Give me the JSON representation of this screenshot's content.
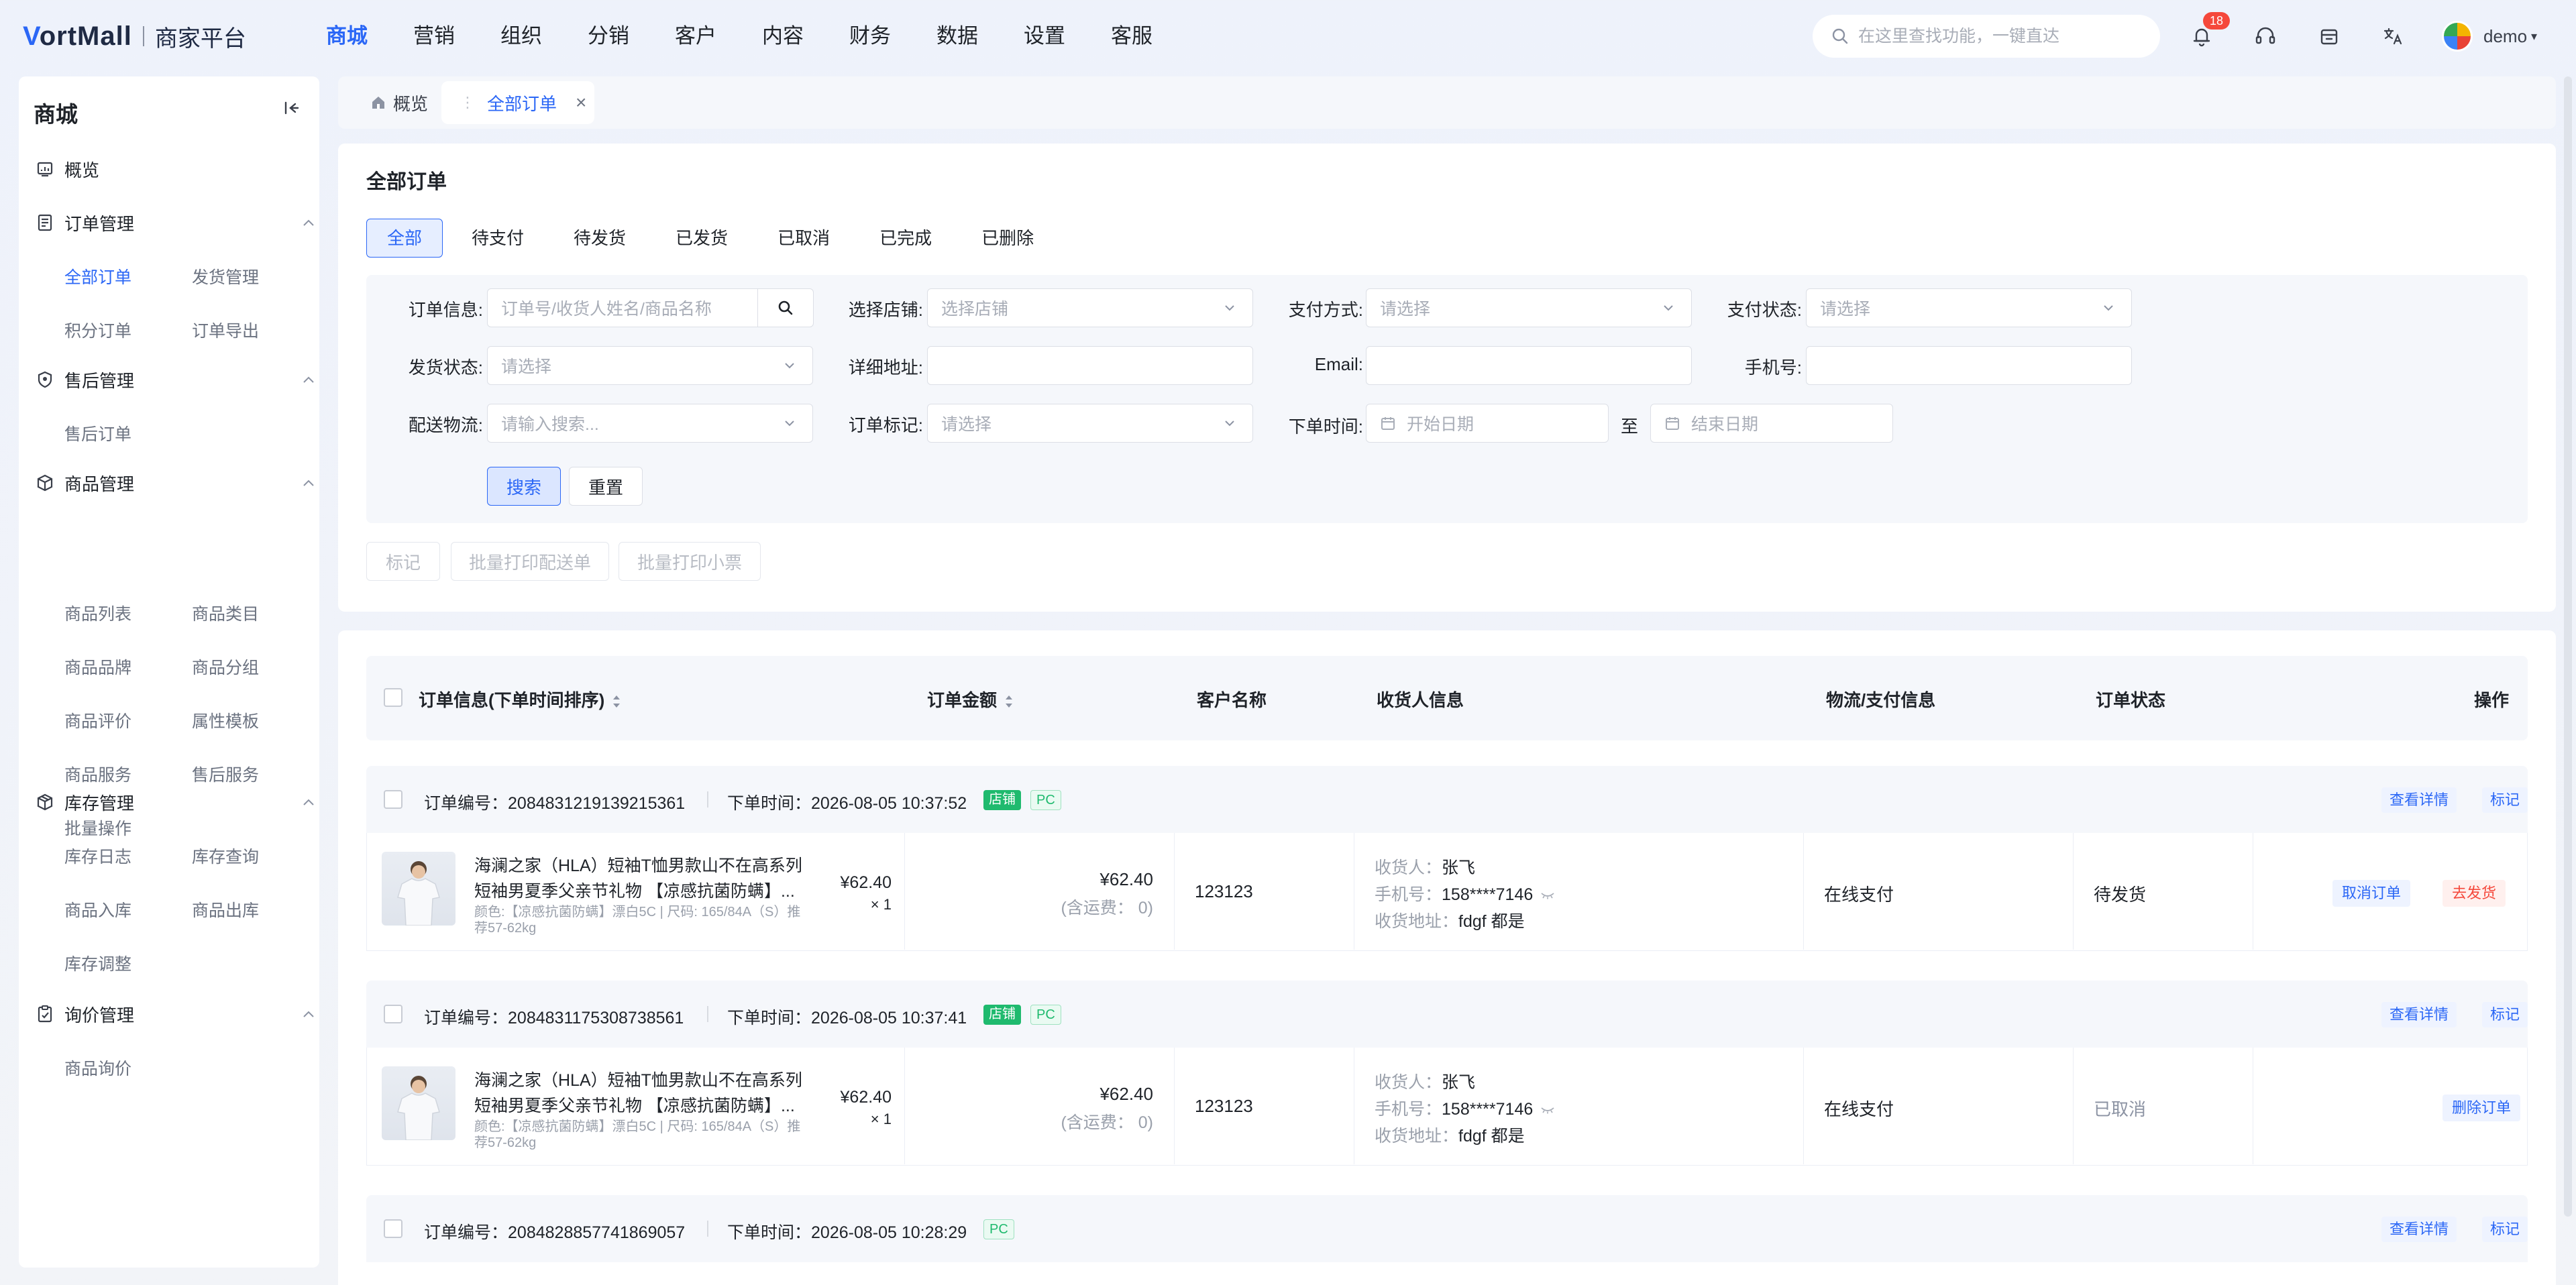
{
  "brand": {
    "logo_mark_v": "V",
    "logo_mark_rest": "ortMall",
    "subtitle": "商家平台"
  },
  "topnav": [
    "商城",
    "营销",
    "组织",
    "分销",
    "客户",
    "内容",
    "财务",
    "数据",
    "设置",
    "客服"
  ],
  "search": {
    "placeholder": "在这里查找功能，一键直达"
  },
  "notifications": {
    "count": "18"
  },
  "user": {
    "name": "demo"
  },
  "sidebar": {
    "title": "商城",
    "overview": "概览",
    "groups": [
      {
        "title": "订单管理",
        "items": [
          "全部订单",
          "发货管理",
          "积分订单",
          "订单导出"
        ]
      },
      {
        "title": "售后管理",
        "items": [
          "售后订单"
        ]
      },
      {
        "title": "商品管理",
        "items": [
          "商品列表",
          "商品类目",
          "商品品牌",
          "商品分组",
          "商品评价",
          "属性模板",
          "商品服务",
          "售后服务",
          "批量操作"
        ]
      },
      {
        "title": "库存管理",
        "items": [
          "库存日志",
          "库存查询",
          "商品入库",
          "商品出库",
          "库存调整"
        ]
      },
      {
        "title": "询价管理",
        "items": [
          "商品询价"
        ]
      }
    ]
  },
  "tabs": {
    "home": "概览",
    "current": "全部订单"
  },
  "filter": {
    "title": "全部订单",
    "status_tabs": [
      "全部",
      "待支付",
      "待发货",
      "已发货",
      "已取消",
      "已完成",
      "已删除"
    ],
    "labels": {
      "order_info": "订单信息:",
      "store": "选择店铺:",
      "pay_method": "支付方式:",
      "pay_status": "支付状态:",
      "ship_status": "发货状态:",
      "address": "详细地址:",
      "email": "Email:",
      "phone": "手机号:",
      "logistics": "配送物流:",
      "order_mark": "订单标记:",
      "order_time": "下单时间:"
    },
    "placeholders": {
      "order_info": "订单号/收货人姓名/商品名称",
      "store": "选择店铺",
      "pay_method": "请选择",
      "pay_status": "请选择",
      "ship_status": "请选择",
      "logistics": "请输入搜索...",
      "order_mark": "请选择",
      "start_date": "开始日期",
      "end_date": "结束日期"
    },
    "to": "至",
    "search_btn": "搜索",
    "reset_btn": "重置",
    "batch": [
      "标记",
      "批量打印配送单",
      "批量打印小票"
    ]
  },
  "table": {
    "headers": {
      "order_info": "订单信息(下单时间排序)",
      "amount": "订单金额",
      "customer": "客户名称",
      "receiver": "收货人信息",
      "logistics_pay": "物流/支付信息",
      "status": "订单状态",
      "action": "操作"
    },
    "orders": [
      {
        "no_label": "订单编号：",
        "no": "2084831219139215361",
        "time_label": "下单时间：",
        "time": "2026-08-05 10:37:52",
        "tags": [
          "店铺",
          "PC"
        ],
        "head_actions": [
          "查看详情",
          "标记"
        ],
        "product_name": "海澜之家（HLA）短袖T恤男款山不在高系列短袖男夏季父亲节礼物 【凉感抗菌防螨】...",
        "product_spec": "颜色:【凉感抗菌防螨】漂白5C | 尺码: 165/84A（S）推荐57-62kg",
        "price": "¥62.40",
        "qty": "× 1",
        "amount": "¥62.40",
        "amount_sub": "(含运费： 0)",
        "customer": "123123",
        "receiver_label": "收货人：",
        "receiver": "张飞",
        "phone_label": "手机号：",
        "phone": "158****7146",
        "addr_label": "收货地址：",
        "addr": "fdgf 都是",
        "pay": "在线支付",
        "status": "待发货",
        "actions": [
          {
            "label": "取消订单",
            "kind": "blue"
          },
          {
            "label": "去发货",
            "kind": "red"
          }
        ]
      },
      {
        "no_label": "订单编号：",
        "no": "2084831175308738561",
        "time_label": "下单时间：",
        "time": "2026-08-05 10:37:41",
        "tags": [
          "店铺",
          "PC"
        ],
        "head_actions": [
          "查看详情",
          "标记"
        ],
        "product_name": "海澜之家（HLA）短袖T恤男款山不在高系列短袖男夏季父亲节礼物 【凉感抗菌防螨】...",
        "product_spec": "颜色:【凉感抗菌防螨】漂白5C | 尺码: 165/84A（S）推荐57-62kg",
        "price": "¥62.40",
        "qty": "× 1",
        "amount": "¥62.40",
        "amount_sub": "(含运费： 0)",
        "customer": "123123",
        "receiver_label": "收货人：",
        "receiver": "张飞",
        "phone_label": "手机号：",
        "phone": "158****7146",
        "addr_label": "收货地址：",
        "addr": "fdgf 都是",
        "pay": "在线支付",
        "status": "已取消",
        "actions": [
          {
            "label": "删除订单",
            "kind": "blue"
          }
        ]
      },
      {
        "no_label": "订单编号：",
        "no": "2084828857741869057",
        "time_label": "下单时间：",
        "time": "2026-08-05 10:28:29",
        "tags": [
          "PC"
        ],
        "head_actions": [
          "查看详情",
          "标记"
        ]
      }
    ]
  },
  "colors": {
    "accent": "#2b67f6",
    "danger": "#f5483b",
    "success": "#1fba6e"
  }
}
